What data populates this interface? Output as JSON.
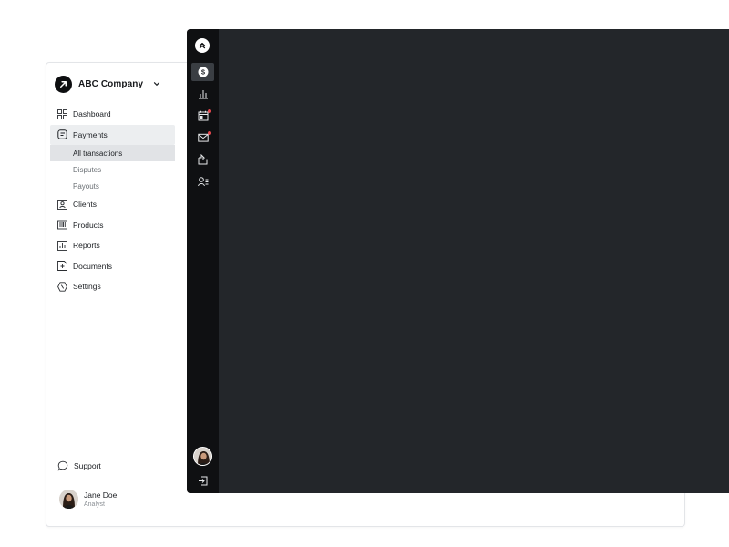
{
  "company": {
    "name": "ABC Company"
  },
  "sidebar": {
    "items": [
      {
        "label": "Dashboard"
      },
      {
        "label": "Payments"
      },
      {
        "label": "Clients"
      },
      {
        "label": "Products"
      },
      {
        "label": "Reports"
      },
      {
        "label": "Documents"
      },
      {
        "label": "Settings"
      }
    ],
    "payments_sub": [
      {
        "label": "All transactions"
      },
      {
        "label": "Disputes"
      },
      {
        "label": "Payouts"
      }
    ],
    "support_label": "Support"
  },
  "user": {
    "name": "Jane Doe",
    "role": "Analyst"
  },
  "rail": {
    "icons": [
      "payments-icon",
      "chart-icon",
      "calendar-icon",
      "mail-icon",
      "documents-icon",
      "users-icon"
    ],
    "notification_color": "#e5484d"
  },
  "colors": {
    "dark_panel": "#23262a",
    "rail": "#0f1012",
    "active_nav": "#eceef0"
  }
}
